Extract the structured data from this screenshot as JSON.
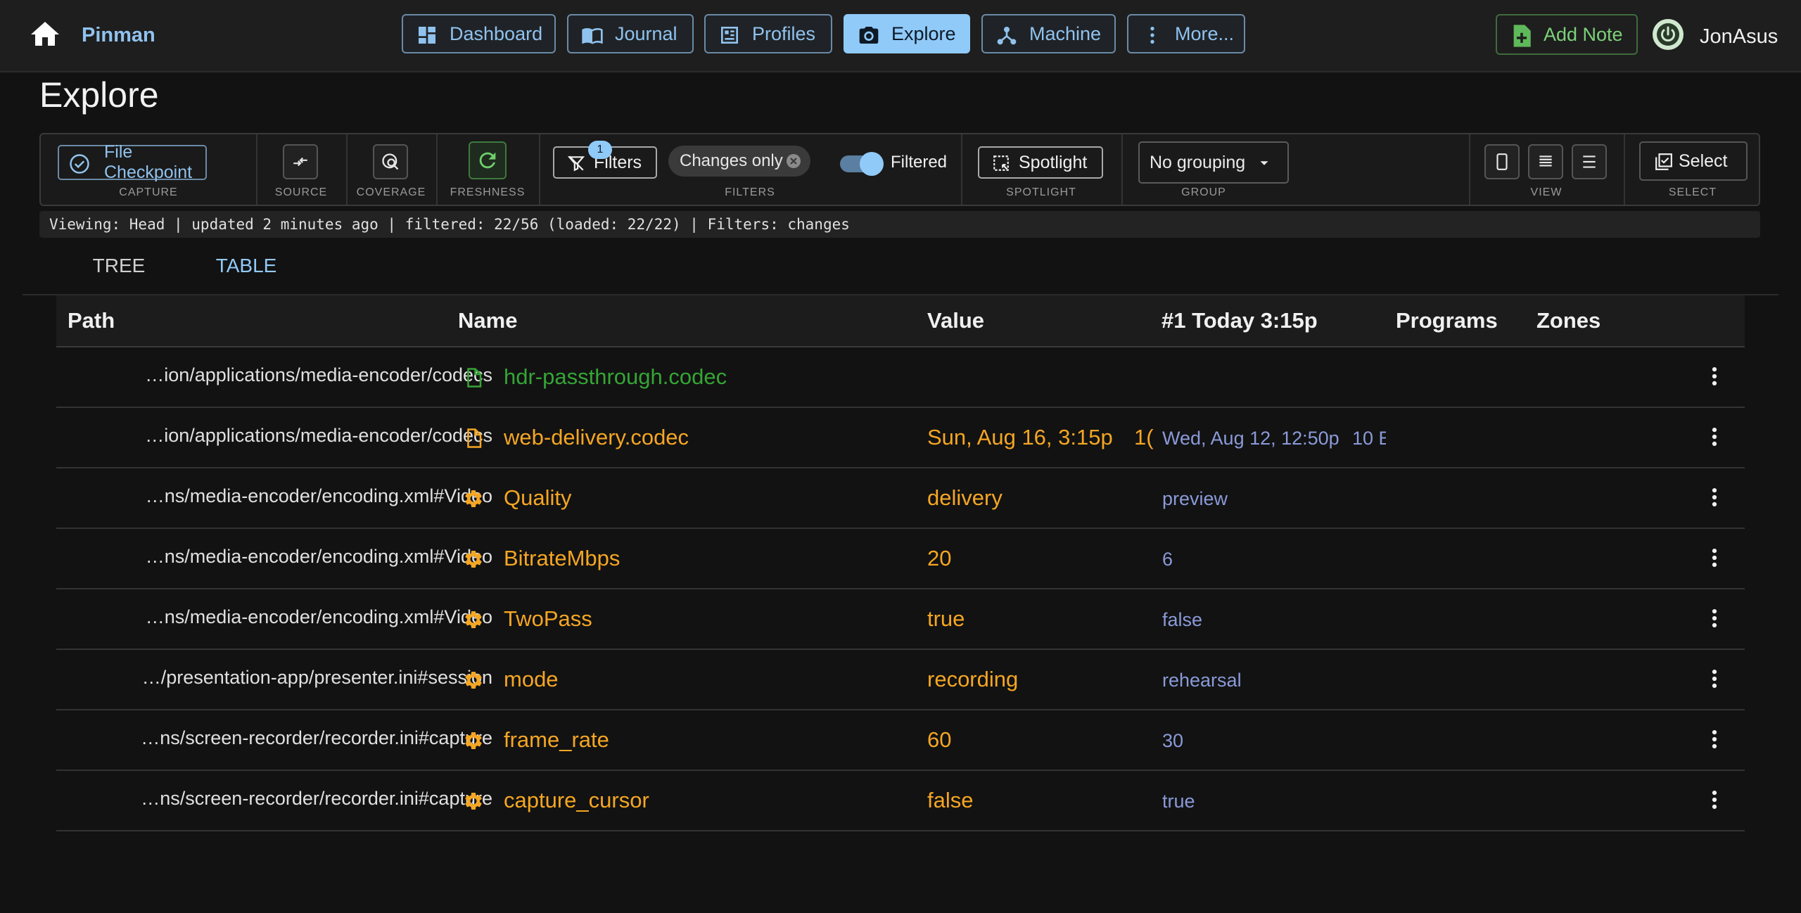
{
  "appbar": {
    "brand": "Pinman",
    "nav": [
      {
        "label": "Dashboard",
        "icon": "dashboard-icon"
      },
      {
        "label": "Journal",
        "icon": "journal-icon"
      },
      {
        "label": "Profiles",
        "icon": "profiles-icon"
      },
      {
        "label": "Explore",
        "icon": "camera-icon",
        "active": true
      },
      {
        "label": "Machine",
        "icon": "machine-icon"
      },
      {
        "label": "More...",
        "icon": "more-vertical-icon"
      }
    ],
    "add_note": "Add Note",
    "user": "JonAsus"
  },
  "page": {
    "title": "Explore"
  },
  "toolbar": {
    "capture": {
      "button": "File Checkpoint",
      "label": "CAPTURE"
    },
    "source": {
      "label": "SOURCE"
    },
    "coverage": {
      "label": "COVERAGE"
    },
    "freshness": {
      "label": "FRESHNESS"
    },
    "filters": {
      "button": "Filters",
      "badge": "1",
      "chip": "Changes only",
      "toggle_label": "Filtered",
      "toggle_on": true,
      "label": "FILTERS"
    },
    "spotlight": {
      "button": "Spotlight",
      "label": "SPOTLIGHT"
    },
    "group": {
      "selected": "No grouping",
      "label": "GROUP"
    },
    "view": {
      "label": "VIEW"
    },
    "select": {
      "button": "Select",
      "label": "SELECT"
    }
  },
  "status": "Viewing: Head | updated 2 minutes ago | filtered: 22/56 (loaded: 22/22) | Filters: changes",
  "tabs": [
    {
      "label": "TREE",
      "active": false
    },
    {
      "label": "TABLE",
      "active": true
    }
  ],
  "table": {
    "columns": [
      "Path",
      "Name",
      "Value",
      "#1 Today 3:15p",
      "Programs",
      "Zones"
    ],
    "rows": [
      {
        "path": "…ion/applications/media-encoder/codecs",
        "icon": "file-icon",
        "name": "hdr-passthrough.codec",
        "name_color": "green",
        "value": "",
        "value_extra": "",
        "previous": "",
        "previous_extra": ""
      },
      {
        "path": "…ion/applications/media-encoder/codecs",
        "icon": "file-icon",
        "name": "web-delivery.codec",
        "name_color": "orange",
        "value": "Sun, Aug 16, 3:15p",
        "value_extra": "1(",
        "previous": "Wed, Aug 12, 12:50p",
        "previous_extra": "10 E"
      },
      {
        "path": "…ns/media-encoder/encoding.xml#Video",
        "icon": "gear-icon",
        "name": "Quality",
        "name_color": "orange",
        "value": "delivery",
        "value_extra": "",
        "previous": "preview",
        "previous_extra": ""
      },
      {
        "path": "…ns/media-encoder/encoding.xml#Video",
        "icon": "gear-icon",
        "name": "BitrateMbps",
        "name_color": "orange",
        "value": "20",
        "value_extra": "",
        "previous": "6",
        "previous_extra": ""
      },
      {
        "path": "…ns/media-encoder/encoding.xml#Video",
        "icon": "gear-icon",
        "name": "TwoPass",
        "name_color": "orange",
        "value": "true",
        "value_extra": "",
        "previous": "false",
        "previous_extra": ""
      },
      {
        "path": "…/presentation-app/presenter.ini#session",
        "icon": "gear-icon",
        "name": "mode",
        "name_color": "orange",
        "value": "recording",
        "value_extra": "",
        "previous": "rehearsal",
        "previous_extra": ""
      },
      {
        "path": "…ns/screen-recorder/recorder.ini#capture",
        "icon": "gear-icon",
        "name": "frame_rate",
        "name_color": "orange",
        "value": "60",
        "value_extra": "",
        "previous": "30",
        "previous_extra": ""
      },
      {
        "path": "…ns/screen-recorder/recorder.ini#capture",
        "icon": "gear-icon",
        "name": "capture_cursor",
        "name_color": "orange",
        "value": "false",
        "value_extra": "",
        "previous": "true",
        "previous_extra": ""
      }
    ]
  },
  "colors": {
    "accent": "#90caf9",
    "changed": "#f5a623",
    "added": "#35a535",
    "previous": "#8a9ad8"
  }
}
